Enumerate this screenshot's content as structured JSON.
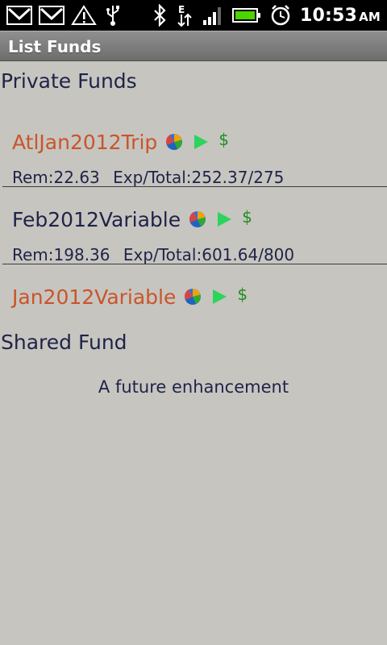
{
  "status_bar": {
    "time": "10:53",
    "ampm": "AM",
    "icons": [
      "gmail-icon",
      "gmail-icon",
      "warning-icon",
      "usb-icon",
      "bluetooth-icon",
      "edge-signal-icon",
      "signal-bars-icon",
      "battery-icon",
      "alarm-icon"
    ],
    "battery_color": "#4cd400"
  },
  "title_bar": {
    "title": "List Funds"
  },
  "private": {
    "header": "Private Funds",
    "funds": [
      {
        "name": "AtlJan2012Trip",
        "name_color": "#c8552b",
        "rem": "Rem:22.63",
        "exp_total": "Exp/Total:252.37/275",
        "icons": [
          "pie-chart-icon",
          "play-icon",
          "dollar-icon"
        ]
      },
      {
        "name": "Feb2012Variable",
        "name_color": "#1e2448",
        "rem": "Rem:198.36",
        "exp_total": "Exp/Total:601.64/800",
        "icons": [
          "pie-chart-icon",
          "play-icon",
          "dollar-icon"
        ]
      },
      {
        "name": "Jan2012Variable",
        "name_color": "#c8552b",
        "icons": [
          "pie-chart-icon",
          "play-icon",
          "dollar-icon"
        ]
      }
    ]
  },
  "shared": {
    "header": "Shared Fund",
    "message": "A future enhancement"
  },
  "icons": {
    "dollar_symbol": "$"
  },
  "colors": {
    "background": "#c7c5c0",
    "navy_text": "#1e2448",
    "orange_text": "#c8552b",
    "green": "#1e8f1e"
  }
}
